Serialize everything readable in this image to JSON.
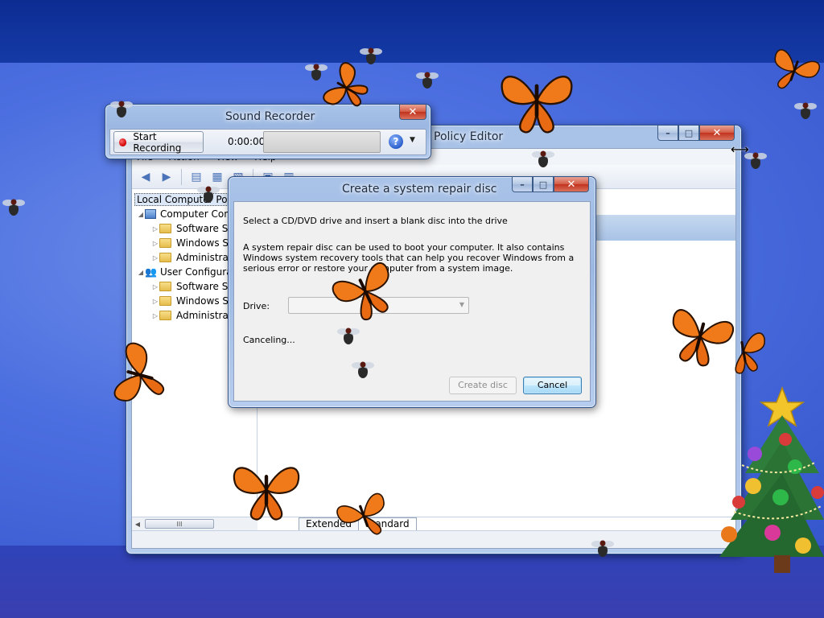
{
  "group_policy_editor": {
    "title_partial": "Policy Editor",
    "menu": [
      "File",
      "Action",
      "View",
      "Help"
    ],
    "tree": {
      "root": "Local Computer Policy",
      "computer_config": "Computer Configuration",
      "user_config": "User Configuration",
      "computer_children": [
        "Software Settings",
        "Windows Settings",
        "Administrative Templates"
      ],
      "user_children": [
        "Software Settings",
        "Windows Settings",
        "Administrative Templates"
      ]
    },
    "tabs": [
      "Extended",
      "Standard"
    ],
    "scroll_thumb": "III"
  },
  "sound_recorder": {
    "title": "Sound Recorder",
    "start_button": "Start Recording",
    "elapsed": "0:00:00",
    "help_icon": "?"
  },
  "repair_dialog": {
    "title": "Create a system repair disc",
    "heading": "Select a CD/DVD drive and insert a blank disc into the drive",
    "description_line1": "A system repair disc can be used to boot your computer. It also contains",
    "description_line2": "Windows system recovery tools that can help you recover Windows from a",
    "description_line3": "serious error or restore your computer from a system image.",
    "drive_label": "Drive:",
    "drive_value": "",
    "status": "Canceling...",
    "create_button": "Create disc",
    "cancel_button": "Cancel"
  },
  "decorations": {
    "butterfly_color": "#f07a1a",
    "desktop_color": "#4c6fe0"
  }
}
